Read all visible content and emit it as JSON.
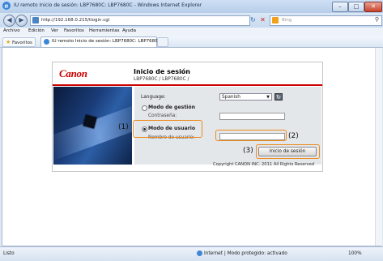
{
  "window": {
    "title": "IU remoto Inicio de sesión: LBP7680C: LBP7680C - Windows Internet Explorer",
    "minimize_icon": "minimize-icon",
    "maximize_icon": "maximize-icon",
    "close_icon": "close-icon"
  },
  "address_bar": {
    "url": "http://192.168.0.215/tlogin.cgi",
    "search_placeholder": "Bing"
  },
  "menu": [
    "Archivo",
    "Edición",
    "Ver",
    "Favoritos",
    "Herramientas",
    "Ayuda"
  ],
  "favorites": {
    "button_label": "Favoritos",
    "tab_label": "IU remoto Inicio de sesión: LBP7680C: LBP7680C"
  },
  "page": {
    "logo_text": "Canon",
    "title": "Inicio de sesión",
    "model": "LBP7680C / LBP7680C /",
    "language_label": "Language:",
    "language_value": "Spanish",
    "mgmt_mode_label": "Modo de gestión",
    "password_label": "Contraseña:",
    "user_mode_label": "Modo de usuario",
    "username_label": "Nombre de usuario:",
    "login_button": "Inicio de sesión",
    "copyright": "Copyright CANON INC. 2011 All Rights Reserved"
  },
  "callouts": {
    "c1": "(1)",
    "c2": "(2)",
    "c3": "(3)"
  },
  "status": {
    "left": "Listo",
    "zone": "Internet | Modo protegido: activado",
    "zoom": "100%"
  },
  "colors": {
    "canon_red": "#cc0000",
    "highlight": "#ee8a1c"
  }
}
